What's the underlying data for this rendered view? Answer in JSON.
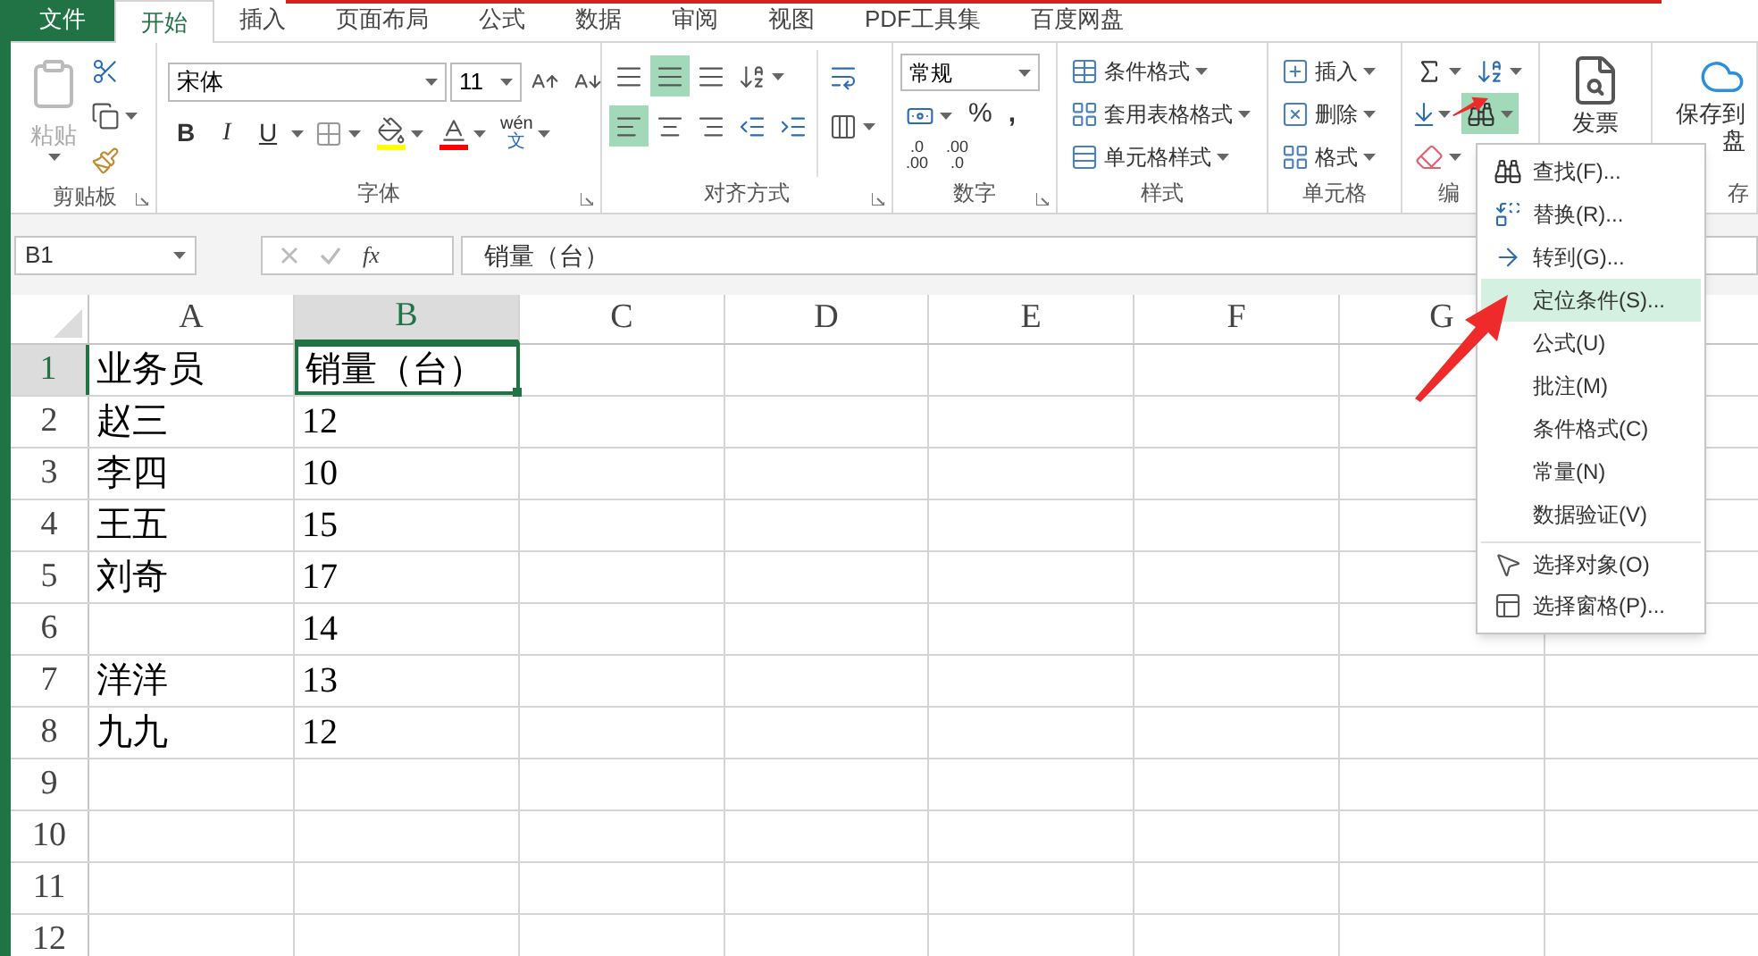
{
  "tabs": [
    {
      "label": "文件",
      "kind": "file",
      "selected": false
    },
    {
      "label": "开始",
      "kind": "tab",
      "selected": true
    },
    {
      "label": "插入",
      "kind": "tab",
      "selected": false
    },
    {
      "label": "页面布局",
      "kind": "tab",
      "selected": false
    },
    {
      "label": "公式",
      "kind": "tab",
      "selected": false
    },
    {
      "label": "数据",
      "kind": "tab",
      "selected": false
    },
    {
      "label": "审阅",
      "kind": "tab",
      "selected": false
    },
    {
      "label": "视图",
      "kind": "tab",
      "selected": false
    },
    {
      "label": "PDF工具集",
      "kind": "tab",
      "selected": false
    },
    {
      "label": "百度网盘",
      "kind": "tab",
      "selected": false
    }
  ],
  "clipboard": {
    "paste": "粘贴",
    "paste_disabled": true,
    "label": "剪贴板"
  },
  "font": {
    "name": "宋体",
    "size": "11",
    "format_buttons": [
      "B",
      "I",
      "U"
    ],
    "phonetic_top": "wén",
    "phonetic_bottom": "文",
    "label": "字体"
  },
  "alignment": {
    "vertical": [
      {
        "selected": false
      },
      {
        "selected": true
      },
      {
        "selected": false
      }
    ],
    "horizontal": [
      {
        "selected": true
      },
      {
        "selected": false
      },
      {
        "selected": false
      }
    ],
    "label": "对齐方式"
  },
  "number": {
    "format": "常规",
    "percent": "%",
    "comma": ",",
    "decimals": [
      {
        "top": ".0",
        "bottom": ".00"
      },
      {
        "top": ".00",
        "bottom": ".0"
      }
    ],
    "label": "数字"
  },
  "styles": {
    "items": [
      "条件格式",
      "套用表格格式",
      "单元格样式"
    ],
    "label": "样式"
  },
  "cells": {
    "items": [
      "插入",
      "删除",
      "格式"
    ],
    "label": "单元格"
  },
  "editing": {
    "label": "编",
    "find_active": true
  },
  "invoice": {
    "label": "发票"
  },
  "baidu": {
    "lines": [
      "保存到",
      "盘"
    ],
    "label": "存"
  },
  "formula_bar": {
    "name_box": "B1",
    "fx": "fx",
    "value": "销量（台）"
  },
  "columns": [
    {
      "label": "A",
      "selected": false
    },
    {
      "label": "B",
      "selected": true
    },
    {
      "label": "C",
      "selected": false
    },
    {
      "label": "D",
      "selected": false
    },
    {
      "label": "E",
      "selected": false
    },
    {
      "label": "F",
      "selected": false
    },
    {
      "label": "G",
      "selected": false
    }
  ],
  "rows": [
    {
      "number": "1",
      "selected": true,
      "cells": [
        {
          "text": "业务员",
          "active": false
        },
        {
          "text": "销量（台）",
          "active": true
        }
      ]
    },
    {
      "number": "2",
      "selected": false,
      "cells": [
        {
          "text": "赵三",
          "active": false
        },
        {
          "text": "12",
          "active": false
        }
      ]
    },
    {
      "number": "3",
      "selected": false,
      "cells": [
        {
          "text": "李四",
          "active": false
        },
        {
          "text": "10",
          "active": false
        }
      ]
    },
    {
      "number": "4",
      "selected": false,
      "cells": [
        {
          "text": "王五",
          "active": false
        },
        {
          "text": "15",
          "active": false
        }
      ]
    },
    {
      "number": "5",
      "selected": false,
      "cells": [
        {
          "text": "刘奇",
          "active": false
        },
        {
          "text": "17",
          "active": false
        }
      ]
    },
    {
      "number": "6",
      "selected": false,
      "cells": [
        {
          "active": false
        },
        {
          "text": "14",
          "active": false
        }
      ]
    },
    {
      "number": "7",
      "selected": false,
      "cells": [
        {
          "text": "洋洋",
          "active": false
        },
        {
          "text": "13",
          "active": false
        }
      ]
    },
    {
      "number": "8",
      "selected": false,
      "cells": [
        {
          "text": "九九",
          "active": false
        },
        {
          "text": "12",
          "active": false
        }
      ]
    },
    {
      "number": "9",
      "selected": false
    },
    {
      "number": "10",
      "selected": false
    },
    {
      "number": "11",
      "selected": false
    },
    {
      "number": "12",
      "selected": false
    }
  ],
  "menu": [
    {
      "label": "查找(F)...",
      "kind": "find",
      "selected": false
    },
    {
      "label": "替换(R)...",
      "kind": "replace",
      "selected": false
    },
    {
      "label": "转到(G)...",
      "kind": "goto",
      "selected": false
    },
    {
      "label": "定位条件(S)...",
      "kind": "plain",
      "selected": true
    },
    {
      "label": "公式(U)",
      "kind": "plain",
      "selected": false
    },
    {
      "label": "批注(M)",
      "kind": "plain",
      "selected": false
    },
    {
      "label": "条件格式(C)",
      "kind": "plain",
      "selected": false
    },
    {
      "label": "常量(N)",
      "kind": "plain",
      "selected": false
    },
    {
      "label": "数据验证(V)",
      "kind": "plain",
      "selected": false
    },
    {
      "label": "选择对象(O)",
      "kind": "pointer",
      "selected": false,
      "separator_before": true
    },
    {
      "label": "选择窗格(P)...",
      "kind": "pane",
      "selected": false
    }
  ]
}
